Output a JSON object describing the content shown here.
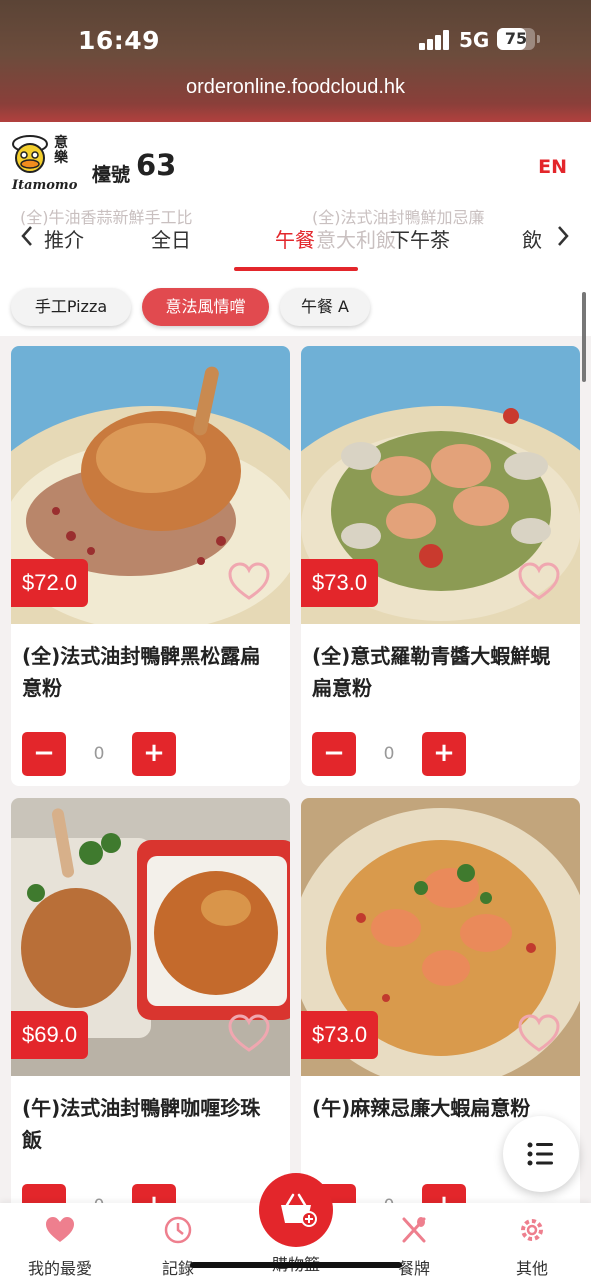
{
  "status": {
    "time": "16:49",
    "network": "5G",
    "battery": "75",
    "url": "orderonline.foodcloud.hk"
  },
  "header": {
    "brand": "Itamomo",
    "brand_cn": "意樂",
    "table_label": "檯號",
    "table_number": "63",
    "lang_toggle": "EN"
  },
  "categories": {
    "ghost_left": "(全)牛油香蒜新鮮手工比",
    "ghost_right": "(全)法式油封鴨鮮加忌廉",
    "items": [
      "推介",
      "全日",
      "午餐",
      "意大利飯",
      "下午茶",
      "飲"
    ],
    "active": "午餐"
  },
  "chips": {
    "items": [
      "手工Pizza",
      "意法風情嚐",
      "午餐 A"
    ],
    "active": "意法風情嚐"
  },
  "products": [
    {
      "name": "(全)法式油封鴨髀黑松露扁意粉",
      "price": "$72.0",
      "qty": "0"
    },
    {
      "name": "(全)意式羅勒青醬大蝦鮮蜆扁意粉",
      "price": "$73.0",
      "qty": "0"
    },
    {
      "name": "(午)法式油封鴨髀咖喱珍珠飯",
      "price": "$69.0",
      "qty": "0"
    },
    {
      "name": "(午)麻辣忌廉大蝦扁意粉",
      "price": "$73.0",
      "qty": "0"
    }
  ],
  "bottom_nav": {
    "favorites": "我的最愛",
    "records": "記錄",
    "cart": "購物籃",
    "menu": "餐牌",
    "others": "其他"
  },
  "colors": {
    "accent": "#e3262b",
    "chip_active": "#e14a4f"
  },
  "icons": [
    "signal-icon",
    "battery-icon",
    "chevron-left-icon",
    "chevron-right-icon",
    "heart-icon",
    "minus-icon",
    "plus-icon",
    "list-icon",
    "clock-icon",
    "basket-icon",
    "utensils-icon",
    "gear-icon"
  ]
}
